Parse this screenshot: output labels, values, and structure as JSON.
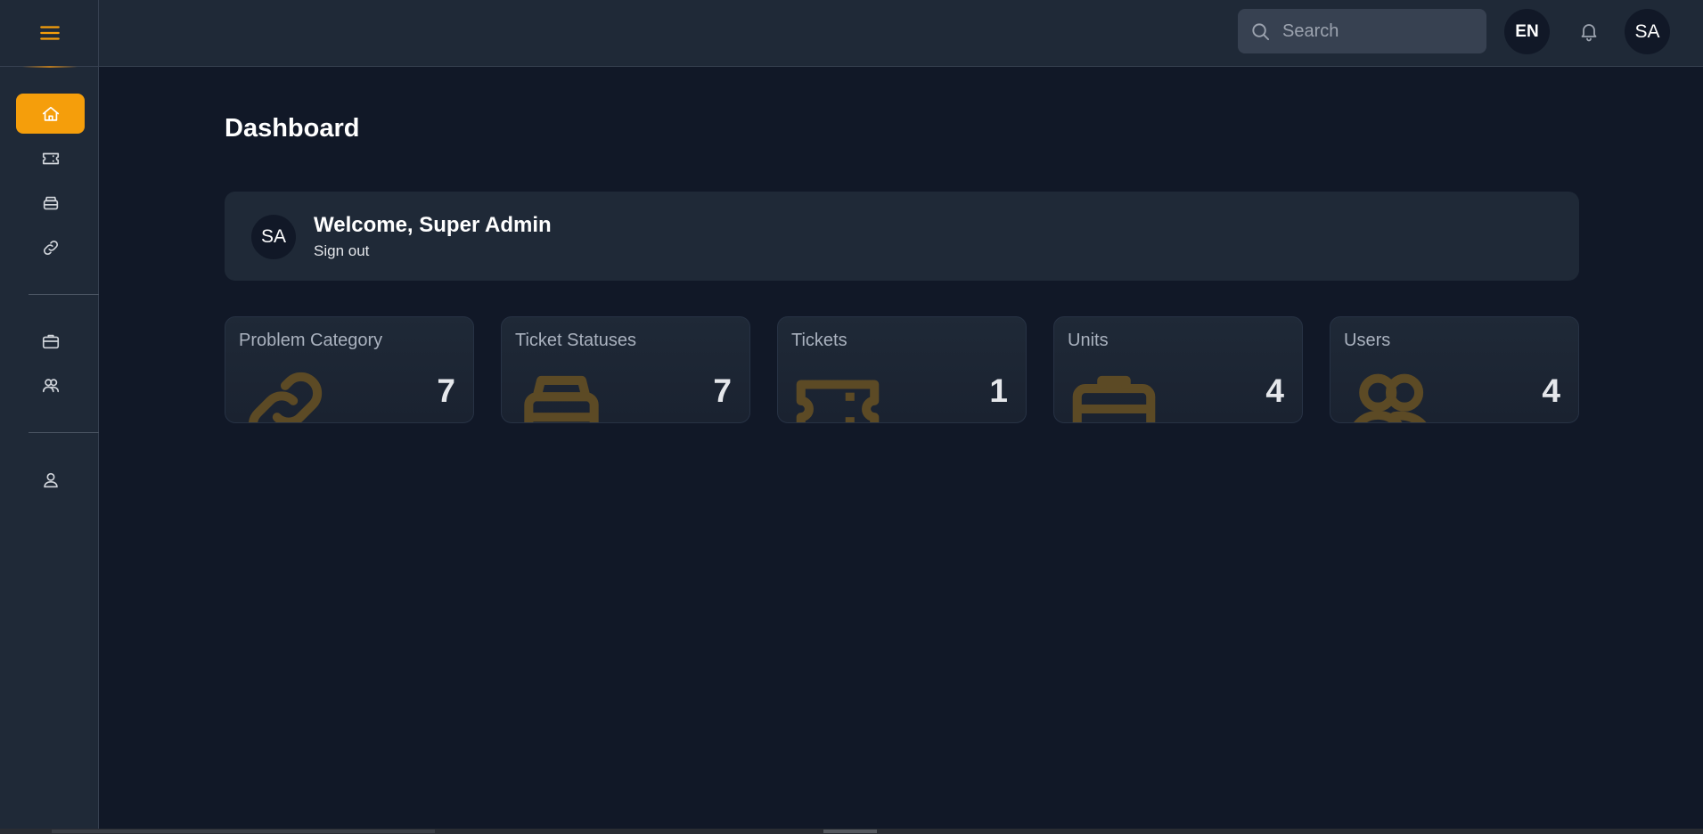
{
  "header": {
    "search_placeholder": "Search",
    "language": "EN",
    "avatar_initials": "SA"
  },
  "sidebar": {
    "items": [
      {
        "icon": "home-icon",
        "active": true
      },
      {
        "icon": "ticket-icon",
        "active": false
      },
      {
        "icon": "inbox-stack-icon",
        "active": false
      },
      {
        "icon": "link-icon",
        "active": false
      },
      {
        "icon": "briefcase-icon",
        "active": false
      },
      {
        "icon": "users-icon",
        "active": false
      },
      {
        "icon": "user-icon",
        "active": false
      }
    ],
    "accent_color": "#f59e0b"
  },
  "main": {
    "title": "Dashboard",
    "welcome": {
      "avatar_initials": "SA",
      "title": "Welcome, Super Admin",
      "signout": "Sign out"
    },
    "stats": [
      {
        "label": "Problem Category",
        "value": "7",
        "icon": "link-icon"
      },
      {
        "label": "Ticket Statuses",
        "value": "7",
        "icon": "inbox-stack-icon"
      },
      {
        "label": "Tickets",
        "value": "1",
        "icon": "ticket-icon"
      },
      {
        "label": "Units",
        "value": "4",
        "icon": "briefcase-icon"
      },
      {
        "label": "Users",
        "value": "4",
        "icon": "users-icon"
      }
    ]
  },
  "colors": {
    "background": "#111827",
    "panel": "#1f2937",
    "accent": "#f59e0b"
  }
}
